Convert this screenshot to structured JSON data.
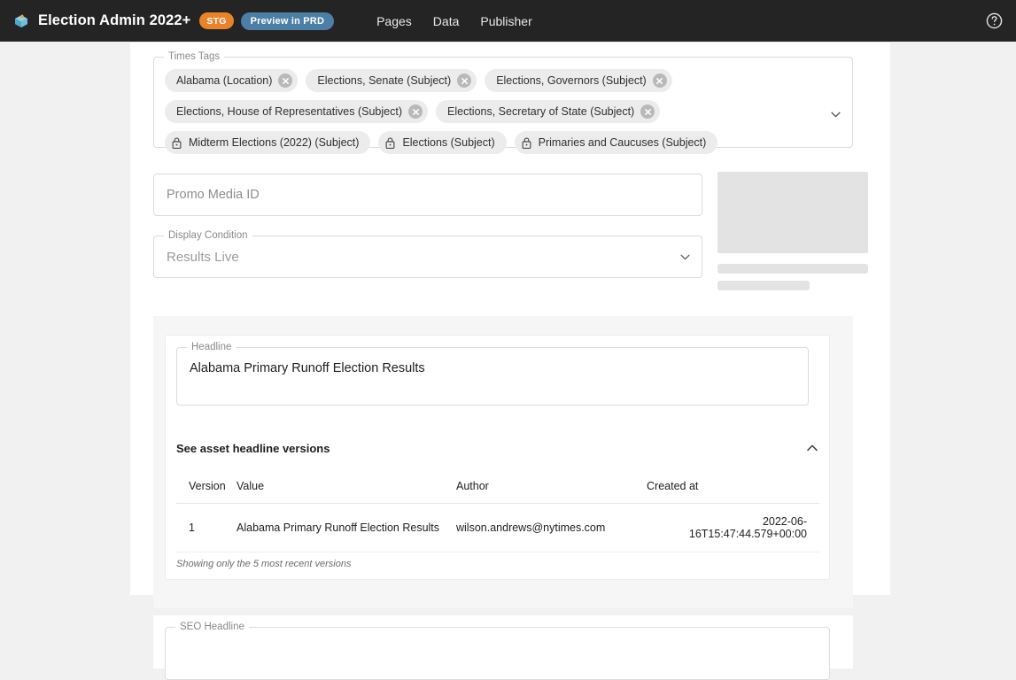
{
  "appbar": {
    "logo_icon": "cube-icon",
    "title": "Election Admin 2022+",
    "env_badge": "STG",
    "preview_button": "Preview in PRD",
    "nav": [
      {
        "label": "Pages"
      },
      {
        "label": "Data"
      },
      {
        "label": "Publisher"
      }
    ],
    "help_icon": "help-circle-icon",
    "bg_color": "#242424",
    "badge_stg_color": "#e8832a",
    "badge_prd_color": "#4b7fa6"
  },
  "times_tags": {
    "legend": "Times Tags",
    "dropdown_icon": "chevron-down-icon",
    "chips": [
      {
        "label": "Alabama (Location)",
        "removable": true,
        "icon": "close-circle-icon"
      },
      {
        "label": "Elections, Senate (Subject)",
        "removable": true,
        "icon": "close-circle-icon"
      },
      {
        "label": "Elections, Governors (Subject)",
        "removable": true,
        "icon": "close-circle-icon"
      },
      {
        "label": "Elections, House of Representatives (Subject)",
        "removable": true,
        "icon": "close-circle-icon"
      },
      {
        "label": "Elections, Secretary of State (Subject)",
        "removable": true,
        "icon": "close-circle-icon"
      },
      {
        "label": "Midterm Elections (2022) (Subject)",
        "removable": false,
        "icon": "lock-icon"
      },
      {
        "label": "Elections (Subject)",
        "removable": false,
        "icon": "lock-icon"
      },
      {
        "label": "Primaries and Caucuses (Subject)",
        "removable": false,
        "icon": "lock-icon"
      }
    ]
  },
  "promo": {
    "media_id_placeholder": "Promo Media ID",
    "media_id_value": "",
    "display_condition_legend": "Display Condition",
    "display_condition_value": "Results Live",
    "display_condition_caret": "chevron-down-icon",
    "media_preview_state": "loading-skeleton"
  },
  "headline_section": {
    "headline_legend": "Headline",
    "headline_value": "Alabama Primary Runoff Election Results",
    "accordion": {
      "title": "See asset headline versions",
      "expanded": true,
      "chevron_icon": "chevron-up-icon"
    },
    "versions_table": {
      "columns": [
        "Version",
        "Value",
        "Author",
        "Created  at"
      ],
      "rows": [
        {
          "version": "1",
          "value": "Alabama Primary Runoff Election Results",
          "author": "wilson.andrews@nytimes.com",
          "created_at": "2022-06-16T15:47:44.579+00:00"
        }
      ],
      "note": "Showing only the 5 most recent versions"
    }
  },
  "seo_section": {
    "legend": "SEO Headline"
  }
}
